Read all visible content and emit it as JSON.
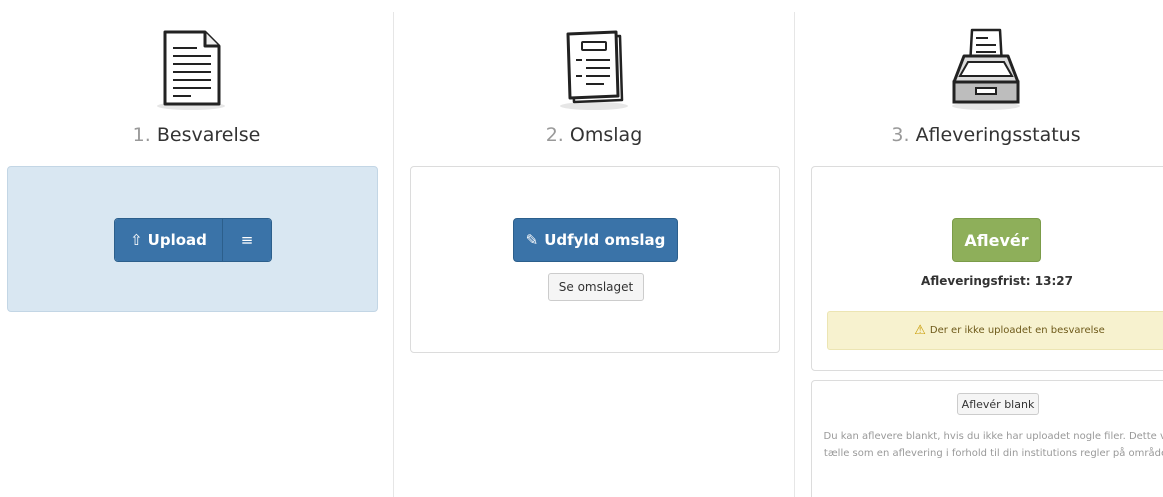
{
  "steps": [
    {
      "number": "1.",
      "title": "Besvarelse",
      "icon": "document-icon"
    },
    {
      "number": "2.",
      "title": "Omslag",
      "icon": "cover-sheet-icon"
    },
    {
      "number": "3.",
      "title": "Afleveringsstatus",
      "icon": "file-tray-icon"
    }
  ],
  "upload": {
    "upload_icon": "⇧",
    "upload_label": "Upload",
    "menu_icon": "≡",
    "panel_color": "#d9e7f2"
  },
  "omslag": {
    "pencil_icon": "✎",
    "fill_label": "Udfyld omslag",
    "view_label": "Se omslaget"
  },
  "status": {
    "submit_label": "Aflevér",
    "deadline_text": "Afleveringsfrist: 13:27",
    "warning_icon": "⚠",
    "warning_text": "Der er ikke uploadet en besvarelse",
    "warning_color": "#f7f2cf",
    "submit_color": "#8eaf5a"
  },
  "blank": {
    "button_label": "Aflevér blank",
    "description": "Du kan aflevere blankt, hvis du ikke har uploadet nogle filer. Dette vil tælle som en aflevering i forhold til din institutions regler på området"
  },
  "colors": {
    "primary": "#3a73a8",
    "step_number": "#999999"
  }
}
